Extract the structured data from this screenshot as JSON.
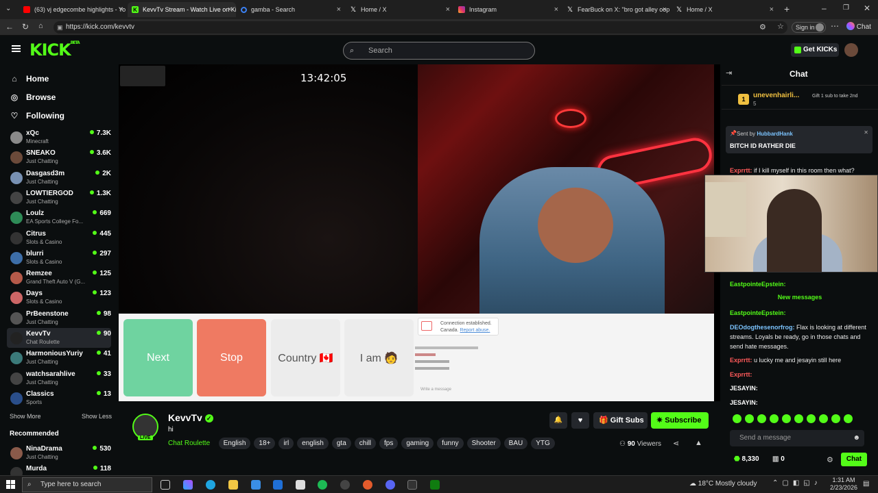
{
  "browser": {
    "tabs": [
      {
        "title": "(63) vj edgecombe highlights - Yo",
        "icon": "youtube-icon",
        "color": "#ff0000"
      },
      {
        "title": "KevvTv Stream - Watch Live on Kic",
        "icon": "kick-icon",
        "color": "#53fc18"
      },
      {
        "title": "gamba - Search",
        "icon": "bing-search-icon",
        "color": "#3b82f6"
      },
      {
        "title": "Home / X",
        "icon": "x-icon",
        "color": "#ffffff"
      },
      {
        "title": "Instagram",
        "icon": "instagram-icon",
        "color": "#e1306c"
      },
      {
        "title": "FearBuck on X: \"bro got alley oop",
        "icon": "x-icon",
        "color": "#ffffff"
      },
      {
        "title": "Home / X",
        "icon": "x-icon",
        "color": "#ffffff"
      }
    ],
    "url": "https://kick.com/kevvtv",
    "signin": "Sign in",
    "chat_label": "Chat"
  },
  "header": {
    "logo": "KICK",
    "logo_badge": "BETA",
    "search_placeholder": "Search",
    "get_kicks": "Get KICKs"
  },
  "sidebar": {
    "nav": [
      {
        "label": "Home",
        "icon": "home-icon"
      },
      {
        "label": "Browse",
        "icon": "compass-icon"
      },
      {
        "label": "Following",
        "icon": "heart-icon"
      }
    ],
    "channels": [
      {
        "name": "xQc",
        "category": "Minecraft",
        "viewers": "7.3K",
        "color": "#8a8a8a"
      },
      {
        "name": "SNEAKO",
        "category": "Just Chatting",
        "viewers": "3.6K",
        "color": "#6b4a3a"
      },
      {
        "name": "Dasgasd3m",
        "category": "Just Chatting",
        "viewers": "2K",
        "color": "#7891b3"
      },
      {
        "name": "LOWTIERGOD",
        "category": "Just Chatting",
        "viewers": "1.3K",
        "color": "#444"
      },
      {
        "name": "Loulz",
        "category": "EA Sports College Fo...",
        "viewers": "669",
        "color": "#2e8b57"
      },
      {
        "name": "Citrus",
        "category": "Slots & Casino",
        "viewers": "445",
        "color": "#333"
      },
      {
        "name": "blurri",
        "category": "Slots & Casino",
        "viewers": "297",
        "color": "#3d6ea8"
      },
      {
        "name": "Remzee",
        "category": "Grand Theft Auto V (G...",
        "viewers": "125",
        "color": "#b55a4a"
      },
      {
        "name": "Days",
        "category": "Slots & Casino",
        "viewers": "123",
        "color": "#c66"
      },
      {
        "name": "PrBeenstone",
        "category": "Just Chatting",
        "viewers": "98",
        "color": "#555"
      },
      {
        "name": "KevvTv",
        "category": "Chat Roulette",
        "viewers": "90",
        "color": "#222"
      },
      {
        "name": "HarmoniousYuriy",
        "category": "Just Chatting",
        "viewers": "41",
        "color": "#3b7a7a"
      },
      {
        "name": "watchsarahlive",
        "category": "Just Chatting",
        "viewers": "33",
        "color": "#444"
      },
      {
        "name": "Classics",
        "category": "Sports",
        "viewers": "13",
        "color": "#2a4e8a"
      }
    ],
    "show_more": "Show More",
    "show_less": "Show Less",
    "recommended_title": "Recommended",
    "recommended": [
      {
        "name": "NinaDrama",
        "category": "Just Chatting",
        "viewers": "530",
        "color": "#8a5a4a"
      },
      {
        "name": "Murda",
        "category": "",
        "viewers": "118",
        "color": "#333"
      }
    ]
  },
  "video": {
    "clock": "13:42:05",
    "buttons": [
      {
        "label": "Next",
        "bg": "#6fd3a0",
        "fg": "#ffffff"
      },
      {
        "label": "Stop",
        "bg": "#ef7a62",
        "fg": "#ffffff"
      },
      {
        "label": "Country 🇨🇦",
        "bg": "#ececec",
        "fg": "#555555"
      },
      {
        "label": "I am 🧑",
        "bg": "#ececec",
        "fg": "#555555"
      }
    ],
    "connection_status": "Connection established.",
    "connection_country": "Canada.",
    "report_link": "Report abuse.",
    "chat_placeholder": "Write a message"
  },
  "stream": {
    "name": "KevvTv",
    "title": "hi",
    "category": "Chat Roulette",
    "live": "LIVE",
    "tags": [
      "English",
      "18+",
      "irl",
      "english",
      "gta",
      "chill",
      "fps",
      "gaming",
      "funny",
      "Shooter",
      "BAU",
      "YTG"
    ],
    "gift_subs": "Gift Subs",
    "subscribe": "Subscribe",
    "viewers": "90",
    "viewers_label": "Viewers"
  },
  "chat": {
    "title": "Chat",
    "top_gifter": "unevenhairli...",
    "top_gifter_rank": "1",
    "top_gifter_count": "5",
    "gift_hint": "Gift 1 sub to take 2nd",
    "pinned_by_label": "Sent by",
    "pinned_by": "HubbardHank",
    "pinned_text": "BITCH ID RATHER DIE",
    "messages_top": [
      {
        "user": "Exprrtt:",
        "text": "if I kill myself in this room then what?",
        "color": "#ff5a5a"
      }
    ],
    "messages": [
      {
        "user": "EastpointeEpstein:",
        "text": "",
        "color": "#53fc18"
      },
      {
        "user": "EastpointeEpstein:",
        "text": "",
        "color": "#53fc18"
      },
      {
        "user": "DEOdogthesenorfrog:",
        "text": "Flax is looking at different streams. Loyals be ready, go in those chats and send hate messages.",
        "color": "#7cc4ff"
      },
      {
        "user": "Exprrtt:",
        "text": "u lucky me and jesayin still here",
        "color": "#ff5a5a"
      },
      {
        "user": "Exprrtt:",
        "text": "",
        "color": "#ff5a5a"
      },
      {
        "user": "JESAYIN:",
        "text": "",
        "color": "#ffffff"
      },
      {
        "user": "JESAYIN:",
        "text": "",
        "color": "#ffffff"
      }
    ],
    "new_messages": "New messages",
    "input_placeholder": "Send a message",
    "points": "8,330",
    "count": "0",
    "send_label": "Chat"
  },
  "taskbar": {
    "search_placeholder": "Type here to search",
    "weather": "18°C  Mostly cloudy",
    "time": "1:31 AM",
    "date": "2/23/2026"
  },
  "colors": {
    "accent": "#53fc18",
    "bg": "#0b0e0f"
  }
}
